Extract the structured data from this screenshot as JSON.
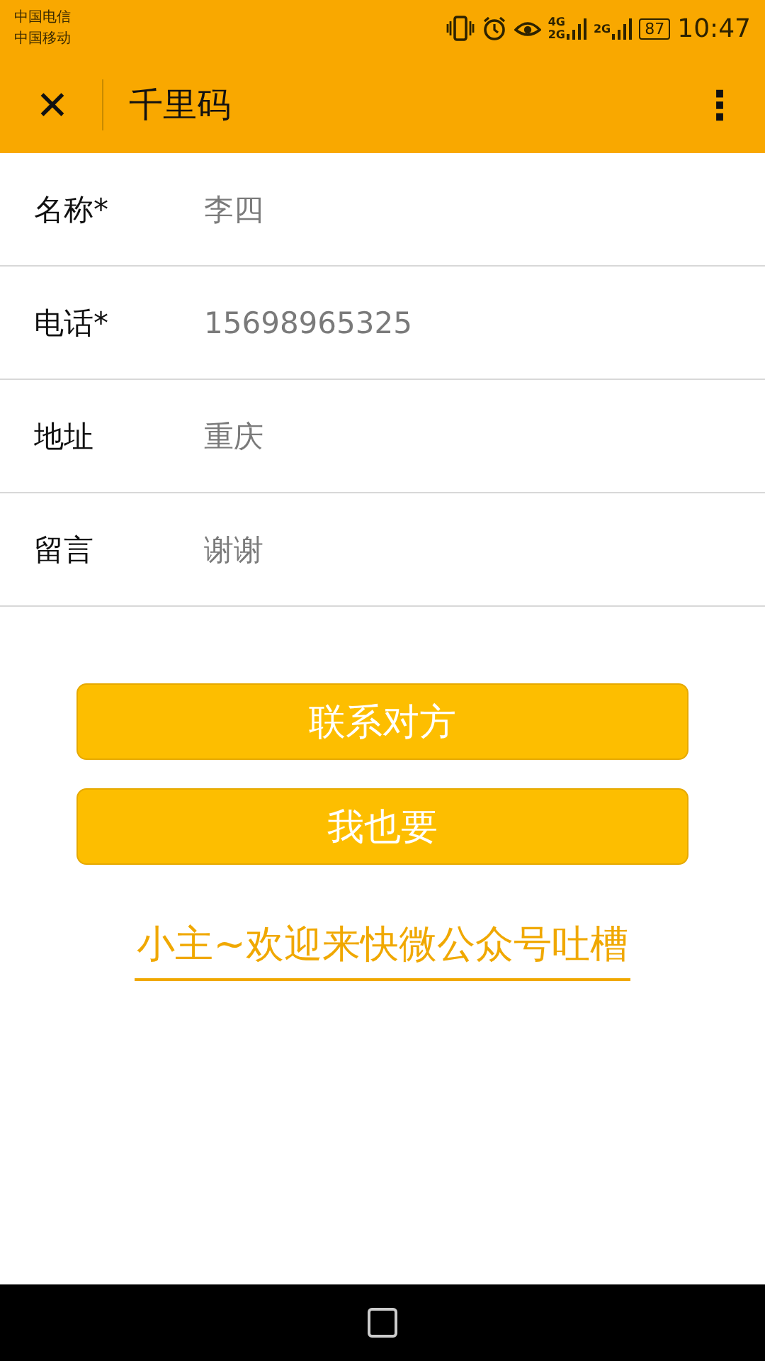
{
  "status_bar": {
    "carriers": [
      "中国电信",
      "中国移动"
    ],
    "networks": [
      {
        "top": "4G",
        "bottom": "2G"
      },
      {
        "top": "2G"
      }
    ],
    "battery": "87",
    "time": "10:47"
  },
  "header": {
    "close": "✕",
    "title": "千里码",
    "menu": "⋮"
  },
  "form": [
    {
      "label": "名称*",
      "value": "李四"
    },
    {
      "label": "电话*",
      "value": "15698965325"
    },
    {
      "label": "地址",
      "value": "重庆"
    },
    {
      "label": "留言",
      "value": "谢谢"
    }
  ],
  "buttons": [
    "联系对方",
    "我也要"
  ],
  "link": "小主~欢迎来快微公众号吐槽"
}
